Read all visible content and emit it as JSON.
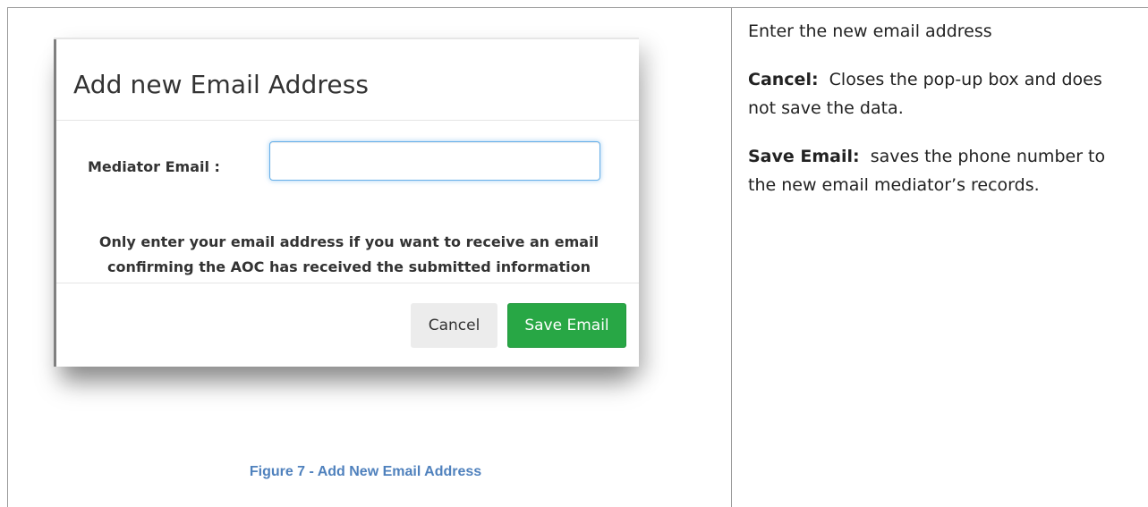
{
  "screenshot": {
    "title": "Add new Email Address",
    "field_label": "Mediator Email :",
    "email_value": "",
    "email_placeholder": "",
    "notice_line1": "Only enter your email address if you want to receive an email",
    "notice_line2": "confirming the AOC has received the submitted information",
    "cancel_label": "Cancel",
    "save_label": "Save Email",
    "save_color": "#28a745",
    "focus_color": "#66afe9"
  },
  "caption": "Figure 7 - Add New Email Address",
  "caption_color": "#4f81bd",
  "description": {
    "intro": "Enter the new email address",
    "cancel_term": "Cancel:",
    "cancel_text": "Closes the pop-up box and does not save the data.",
    "save_term": "Save Email:",
    "save_text": "saves the phone number to the new email mediator’s records."
  }
}
